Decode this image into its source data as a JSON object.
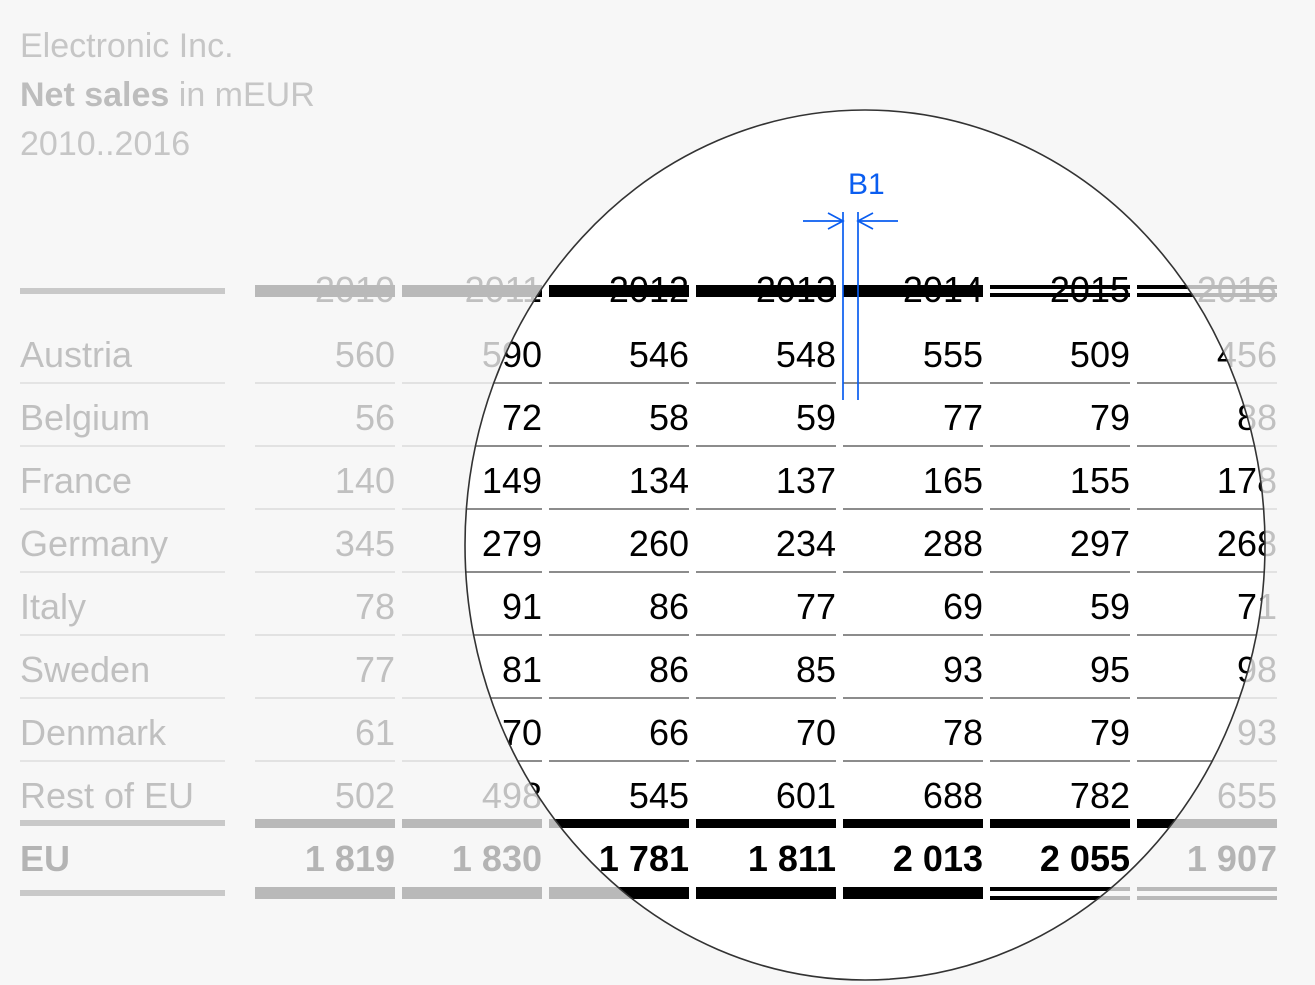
{
  "title": {
    "company": "Electronic Inc.",
    "metric_bold": "Net sales",
    "metric_rest": " in mEUR",
    "period": "2010..2016"
  },
  "annotation": {
    "label": "B1",
    "color": "#0a5df0",
    "meaning": "column-gap-dimension"
  },
  "highlight": {
    "shape": "ellipse",
    "inside_color": "#000000",
    "inside_background": "#ffffff",
    "outside_color": "#c0c0c0",
    "outside_background": "#f7f7f7",
    "outline_color": "#333333"
  },
  "chart_data": {
    "type": "table",
    "title": "Net sales in mEUR",
    "subtitle": "Electronic Inc. 2010..2016",
    "row_header": "",
    "categories": [
      "2010",
      "2011",
      "2012",
      "2013",
      "2014",
      "2015",
      "2016"
    ],
    "rows": [
      {
        "label": "Austria",
        "values": [
          560,
          590,
          546,
          548,
          555,
          509,
          456
        ]
      },
      {
        "label": "Belgium",
        "values": [
          56,
          72,
          58,
          59,
          77,
          79,
          88
        ]
      },
      {
        "label": "France",
        "values": [
          140,
          149,
          134,
          137,
          165,
          155,
          178
        ]
      },
      {
        "label": "Germany",
        "values": [
          345,
          279,
          260,
          234,
          288,
          297,
          268
        ]
      },
      {
        "label": "Italy",
        "values": [
          78,
          91,
          86,
          77,
          69,
          59,
          71
        ]
      },
      {
        "label": "Sweden",
        "values": [
          77,
          81,
          86,
          85,
          93,
          95,
          98
        ]
      },
      {
        "label": "Denmark",
        "values": [
          61,
          70,
          66,
          70,
          78,
          79,
          93
        ]
      },
      {
        "label": "Rest of EU",
        "values": [
          502,
          498,
          545,
          601,
          688,
          782,
          655
        ]
      }
    ],
    "total_row": {
      "label": "EU",
      "values": [
        "1 819",
        "1 830",
        "1 781",
        "1 811",
        "2 013",
        "2 055",
        "1 907"
      ]
    },
    "display_rows": [
      {
        "label": "Austria",
        "cells": [
          "560",
          "590",
          "546",
          "548",
          "555",
          "509",
          "456"
        ]
      },
      {
        "label": "Belgium",
        "cells": [
          "56",
          "72",
          "58",
          "59",
          "77",
          "79",
          "88"
        ]
      },
      {
        "label": "France",
        "cells": [
          "140",
          "149",
          "134",
          "137",
          "165",
          "155",
          "178"
        ]
      },
      {
        "label": "Germany",
        "cells": [
          "345",
          "279",
          "260",
          "234",
          "288",
          "297",
          "268"
        ]
      },
      {
        "label": "Italy",
        "cells": [
          "78",
          "91",
          "86",
          "77",
          "69",
          "59",
          "71"
        ]
      },
      {
        "label": "Sweden",
        "cells": [
          "77",
          "81",
          "86",
          "85",
          "93",
          "95",
          "98"
        ]
      },
      {
        "label": "Denmark",
        "cells": [
          "61",
          "70",
          "66",
          "70",
          "78",
          "79",
          "93"
        ]
      },
      {
        "label": "Rest of EU",
        "cells": [
          "502",
          "498",
          "545",
          "601",
          "688",
          "782",
          "655"
        ]
      }
    ],
    "units": "mEUR",
    "ylabel": "",
    "xlabel": ""
  }
}
